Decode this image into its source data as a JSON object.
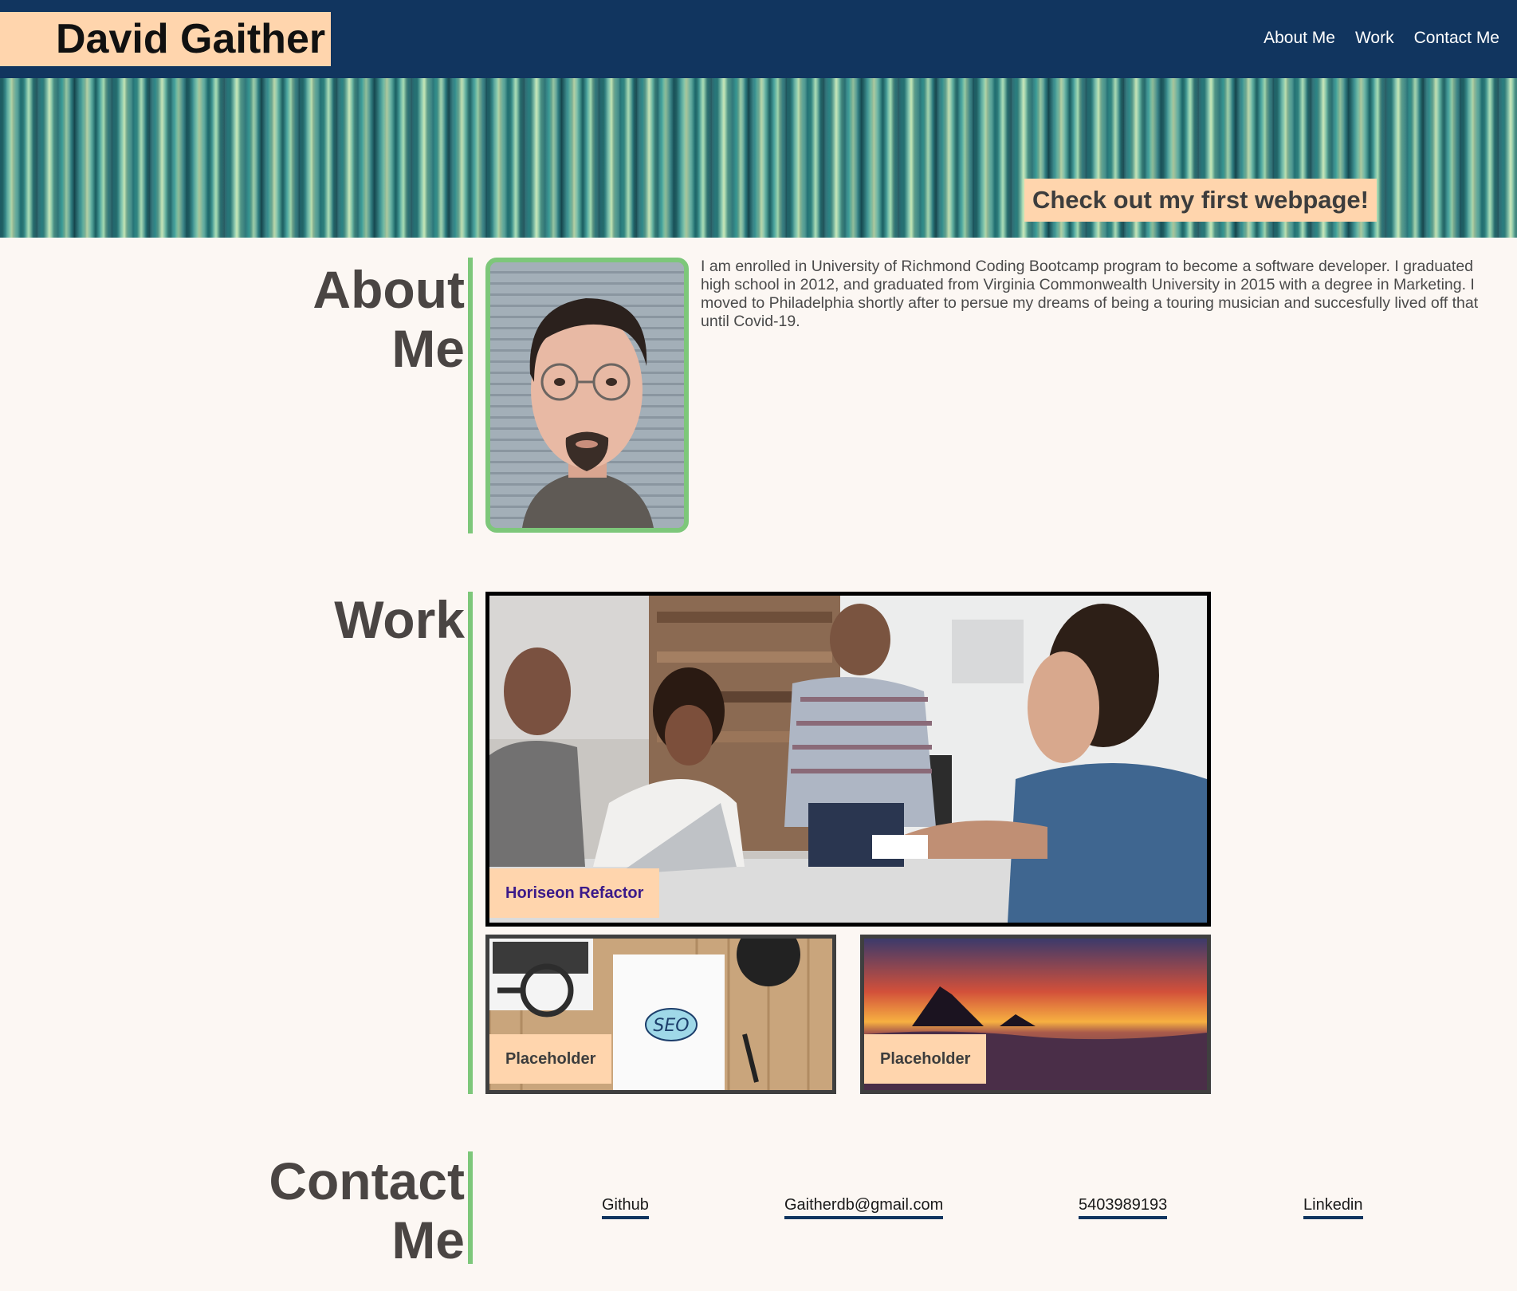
{
  "header": {
    "name": "David Gaither",
    "nav": [
      {
        "label": "About Me"
      },
      {
        "label": "Work"
      },
      {
        "label": "Contact Me"
      }
    ]
  },
  "hero": {
    "cta": "Check out my first webpage!"
  },
  "about": {
    "title_line1": "About",
    "title_line2": "Me",
    "text": "I am enrolled in University of Richmond Coding Bootcamp program to become a software developer. I graduated high school in 2012, and graduated from Virginia Commonwealth University in 2015 with a degree in Marketing. I moved to Philadelphia shortly after to persue my dreams of being a touring musician and succesfully lived off that until Covid-19."
  },
  "work": {
    "title": "Work",
    "projects": [
      {
        "label": "Horiseon Refactor"
      },
      {
        "label": "Placeholder"
      },
      {
        "label": "Placeholder"
      }
    ]
  },
  "contact": {
    "title_line1": "Contact",
    "title_line2": "Me",
    "links": [
      {
        "label": "Github"
      },
      {
        "label": "Gaitherdb@gmail.com"
      },
      {
        "label": "5403989193"
      },
      {
        "label": "Linkedin"
      }
    ]
  },
  "colors": {
    "navy": "#11355f",
    "peach": "#ffd5ad",
    "green": "#7dc77a",
    "background": "#fcf7f3"
  }
}
